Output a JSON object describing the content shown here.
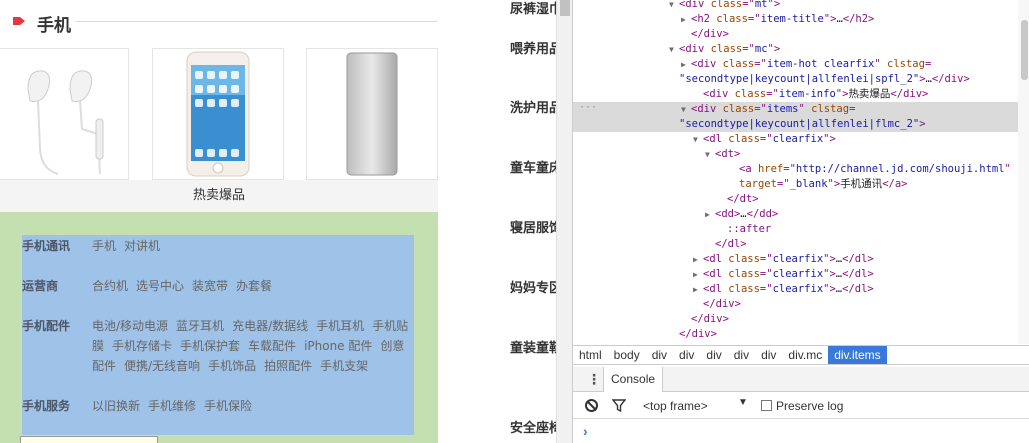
{
  "section": {
    "title": "手机"
  },
  "products": [
    {
      "name": "earphones",
      "icon": "earphones-image"
    },
    {
      "name": "iphone",
      "icon": "smartphone-image"
    },
    {
      "name": "power bank",
      "icon": "power-bank-image"
    }
  ],
  "hot_label": "热卖爆品",
  "categories": [
    {
      "title": "手机通讯",
      "items": [
        "手机",
        "对讲机"
      ]
    },
    {
      "title": "运营商",
      "items": [
        "合约机",
        "选号中心",
        "装宽带",
        "办套餐"
      ]
    },
    {
      "title": "手机配件",
      "items": [
        "电池/移动电源",
        "蓝牙耳机",
        "充电器/数据线",
        "手机耳机",
        "手机贴膜",
        "手机存储卡",
        "手机保护套",
        "车载配件",
        "iPhone 配件",
        "创意配件",
        "便携/无线音响",
        "手机饰品",
        "拍照配件",
        "手机支架"
      ]
    },
    {
      "title": "手机服务",
      "items": [
        "以旧换新",
        "手机维修",
        "手机保险"
      ]
    }
  ],
  "mid_categories": [
    "尿裤湿巾",
    "喂养用品",
    "洗护用品",
    "童车童床",
    "寝居服饰",
    "妈妈专区",
    "童装童鞋",
    "安全座椅"
  ],
  "devtools": {
    "tree": [
      {
        "indent": 8,
        "tri": "▼",
        "html": "<span class='tag'>&lt;div </span><span class='attr'>class</span><span class='tag'>=\"</span><span class='val'>mt</span><span class='tag'>\"&gt;</span>"
      },
      {
        "indent": 9,
        "tri": "▶",
        "html": "<span class='tag'>&lt;h2 </span><span class='attr'>class</span><span class='tag'>=\"</span><span class='val'>item-title</span><span class='tag'>\"&gt;</span><span class='txt'>…</span><span class='tag'>&lt;/h2&gt;</span>"
      },
      {
        "indent": 9,
        "tri": "",
        "html": "<span class='tag'>&lt;/div&gt;</span>"
      },
      {
        "indent": 8,
        "tri": "▼",
        "html": "<span class='tag'>&lt;div </span><span class='attr'>class</span><span class='tag'>=\"</span><span class='val'>mc</span><span class='tag'>\"&gt;</span>"
      },
      {
        "indent": 9,
        "tri": "▶",
        "html": "<span class='tag'>&lt;div </span><span class='attr'>class</span><span class='tag'>=\"</span><span class='val'>item-hot clearfix</span><span class='tag'>\" </span><span class='attr'>clstag</span><span class='tag'>=</span>"
      },
      {
        "indent": 9,
        "tri": "",
        "html": "<span class='val'>\"secondtype|keycount|allfenlei|spfl_2\"</span><span class='tag'>&gt;</span><span class='txt'>…</span><span class='tag'>&lt;/div&gt;</span>",
        "offset": -12
      },
      {
        "indent": 10,
        "tri": "",
        "html": "<span class='tag'>&lt;div </span><span class='attr'>class</span><span class='tag'>=\"</span><span class='val'>item-info</span><span class='tag'>\"&gt;</span><span class='txt'>热卖爆品</span><span class='tag'>&lt;/div&gt;</span>"
      },
      {
        "indent": 9,
        "tri": "▼",
        "selected": true,
        "html": "<span class='tag'>&lt;div </span><span class='attr'>class</span><span class='tag'>=\"</span><span class='val'>items</span><span class='tag'>\" </span><span class='attr'>clstag</span><span class='tag'>=</span>"
      },
      {
        "indent": 9,
        "tri": "",
        "selected": true,
        "html": "<span class='val'>\"secondtype|keycount|allfenlei|flmc_2\"</span><span class='tag'>&gt;</span>",
        "offset": -12
      },
      {
        "indent": 10,
        "tri": "▼",
        "html": "<span class='tag'>&lt;dl </span><span class='attr'>class</span><span class='tag'>=\"</span><span class='val'>clearfix</span><span class='tag'>\"&gt;</span>"
      },
      {
        "indent": 11,
        "tri": "▼",
        "html": "<span class='tag'>&lt;dt&gt;</span>"
      },
      {
        "indent": 13,
        "tri": "",
        "html": "<span class='tag'>&lt;a </span><span class='attr'>href</span><span class='tag'>=\"</span><span class='val'>http://channel.jd.com/shouji.html</span><span class='tag'>\"</span>"
      },
      {
        "indent": 13,
        "tri": "",
        "html": "<span class='attr'>target</span><span class='tag'>=\"</span><span class='val'>_blank</span><span class='tag'>\"&gt;</span><span class='txt'>手机通讯</span><span class='tag'>&lt;/a&gt;</span>"
      },
      {
        "indent": 12,
        "tri": "",
        "html": "<span class='tag'>&lt;/dt&gt;</span>"
      },
      {
        "indent": 11,
        "tri": "▶",
        "html": "<span class='tag'>&lt;dd&gt;</span><span class='txt'>…</span><span class='tag'>&lt;/dd&gt;</span>"
      },
      {
        "indent": 12,
        "tri": "",
        "html": "<span class='pseudo'>::after</span>"
      },
      {
        "indent": 11,
        "tri": "",
        "html": "<span class='tag'>&lt;/dl&gt;</span>"
      },
      {
        "indent": 10,
        "tri": "▶",
        "html": "<span class='tag'>&lt;dl </span><span class='attr'>class</span><span class='tag'>=\"</span><span class='val'>clearfix</span><span class='tag'>\"&gt;</span><span class='txt'>…</span><span class='tag'>&lt;/dl&gt;</span>"
      },
      {
        "indent": 10,
        "tri": "▶",
        "html": "<span class='tag'>&lt;dl </span><span class='attr'>class</span><span class='tag'>=\"</span><span class='val'>clearfix</span><span class='tag'>\"&gt;</span><span class='txt'>…</span><span class='tag'>&lt;/dl&gt;</span>"
      },
      {
        "indent": 10,
        "tri": "▶",
        "html": "<span class='tag'>&lt;dl </span><span class='attr'>class</span><span class='tag'>=\"</span><span class='val'>clearfix</span><span class='tag'>\"&gt;</span><span class='txt'>…</span><span class='tag'>&lt;/dl&gt;</span>"
      },
      {
        "indent": 10,
        "tri": "",
        "html": "<span class='tag'>&lt;/div&gt;</span>"
      },
      {
        "indent": 9,
        "tri": "",
        "html": "<span class='tag'>&lt;/div&gt;</span>"
      },
      {
        "indent": 8,
        "tri": "",
        "html": "<span class='tag'>&lt;/div&gt;</span>"
      }
    ],
    "breadcrumbs": [
      "html",
      "body",
      "div",
      "div",
      "div",
      "div",
      "div",
      "div.mc",
      "div.items"
    ],
    "active_crumb": 8,
    "console_tab": "Console",
    "frame": "<top frame>",
    "preserve_log": "Preserve log"
  }
}
